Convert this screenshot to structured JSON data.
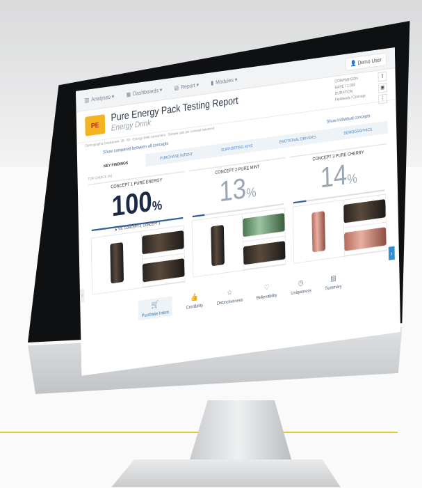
{
  "app": {
    "nav": [
      {
        "icon": "chart-icon",
        "label": "Analyses ▾"
      },
      {
        "icon": "grid-icon",
        "label": "Dashboards ▾"
      },
      {
        "icon": "document-icon",
        "label": "Report ▾"
      },
      {
        "icon": "bar-icon",
        "label": "Modules ▾"
      }
    ],
    "user_label": "Demo User",
    "report_title": "Pure Energy Pack Testing Report",
    "report_subtitle": "Energy Drink",
    "logo_text": "PE",
    "side_info": [
      "COMPARISON",
      "BASE / 1,000",
      "DURATION",
      "Fieldwork / Concept"
    ],
    "fineprint": "Demographic breakdown: 18 - 65 · Energy drink consumers · Sample size per concept balanced",
    "link_left": "Show compared between all concepts",
    "link_right": "Show individual concepts",
    "tabs": [
      "KEY FINDINGS",
      "PURCHASE INTENT",
      "SUPPORTING KPIS",
      "EMOTIONAL DRIVERS",
      "DEMOGRAPHICS"
    ],
    "section_label": "TOP CHOICE (%)",
    "concepts": [
      {
        "name": "CONCEPT 1 PURE ENERGY",
        "pct": "100",
        "fill": 1.0,
        "note": "▲ VS. CONCEPT 2, CONCEPT 3"
      },
      {
        "name": "CONCEPT 2 PURE MINT",
        "pct": "13",
        "fill": 0.13,
        "note": ""
      },
      {
        "name": "CONCEPT 3 PURE CHERRY",
        "pct": "14",
        "fill": 0.14,
        "note": ""
      }
    ],
    "pct_sign": "%",
    "bottom_nav": [
      {
        "icon": "cart-icon",
        "label": "Purchase Intent",
        "active": true
      },
      {
        "icon": "thumb-icon",
        "label": "Credibility",
        "active": false
      },
      {
        "icon": "star-icon",
        "label": "Distinctiveness",
        "active": false
      },
      {
        "icon": "heart-icon",
        "label": "Believability",
        "active": false
      },
      {
        "icon": "clock-icon",
        "label": "Uniqueness",
        "active": false
      },
      {
        "icon": "summary-icon",
        "label": "Summary",
        "active": false
      }
    ]
  },
  "colors": {
    "accent": "#2f8fd0",
    "brand": "#f4b320",
    "headline": "#1a2a44"
  }
}
